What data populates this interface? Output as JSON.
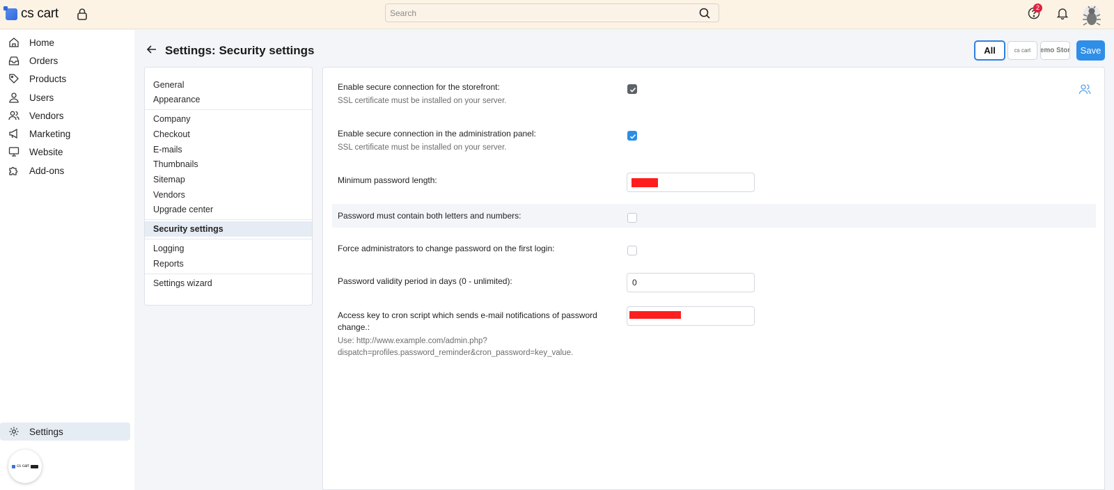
{
  "brand": {
    "name": "cs cart"
  },
  "search": {
    "placeholder": "Search"
  },
  "header": {
    "help_badge_count": "2"
  },
  "sidebar": {
    "items": [
      {
        "label": "Home",
        "icon": "home-icon"
      },
      {
        "label": "Orders",
        "icon": "inbox-icon"
      },
      {
        "label": "Products",
        "icon": "tag-icon"
      },
      {
        "label": "Users",
        "icon": "user-icon"
      },
      {
        "label": "Vendors",
        "icon": "users-icon"
      },
      {
        "label": "Marketing",
        "icon": "megaphone-icon"
      },
      {
        "label": "Website",
        "icon": "monitor-icon"
      },
      {
        "label": "Add-ons",
        "icon": "puzzle-icon"
      }
    ],
    "settings_label": "Settings",
    "mini_logo_text": "cs cart"
  },
  "page": {
    "title": "Settings: Security settings",
    "store_buttons": {
      "all": "All",
      "store1": "cs cart",
      "store2": "emo Stor"
    },
    "save_label": "Save"
  },
  "sections": {
    "items": [
      "General",
      "Appearance",
      "Company",
      "Checkout",
      "E-mails",
      "Thumbnails",
      "Sitemap",
      "Vendors",
      "Upgrade center",
      "Security settings",
      "Logging",
      "Reports",
      "Settings wizard"
    ],
    "active": "Security settings"
  },
  "settings": {
    "secure_storefront": {
      "label": "Enable secure connection for the storefront:",
      "hint": "SSL certificate must be installed on your server.",
      "checked": true
    },
    "secure_admin": {
      "label": "Enable secure connection in the administration panel:",
      "hint": "SSL certificate must be installed on your server.",
      "checked": true
    },
    "min_password_length": {
      "label": "Minimum password length:",
      "value": ""
    },
    "letters_numbers": {
      "label": "Password must contain both letters and numbers:",
      "checked": false
    },
    "force_change": {
      "label": "Force administrators to change password on the first login:",
      "checked": false
    },
    "validity_period": {
      "label": "Password validity period in days (0 - unlimited):",
      "value": "0"
    },
    "cron_key": {
      "label_line1": "Access key to cron script which sends e-mail notifications of password",
      "label_line2": "change.:",
      "hint_line1": "Use: http://www.example.com/admin.php?",
      "hint_line2": "dispatch=profiles.password_reminder&cron_password=key_value.",
      "value": ""
    }
  },
  "colors": {
    "accent": "#2f8ee8",
    "topbar": "#fdf3e5",
    "badge": "#e0203f",
    "redaction": "#ff1e1e"
  }
}
